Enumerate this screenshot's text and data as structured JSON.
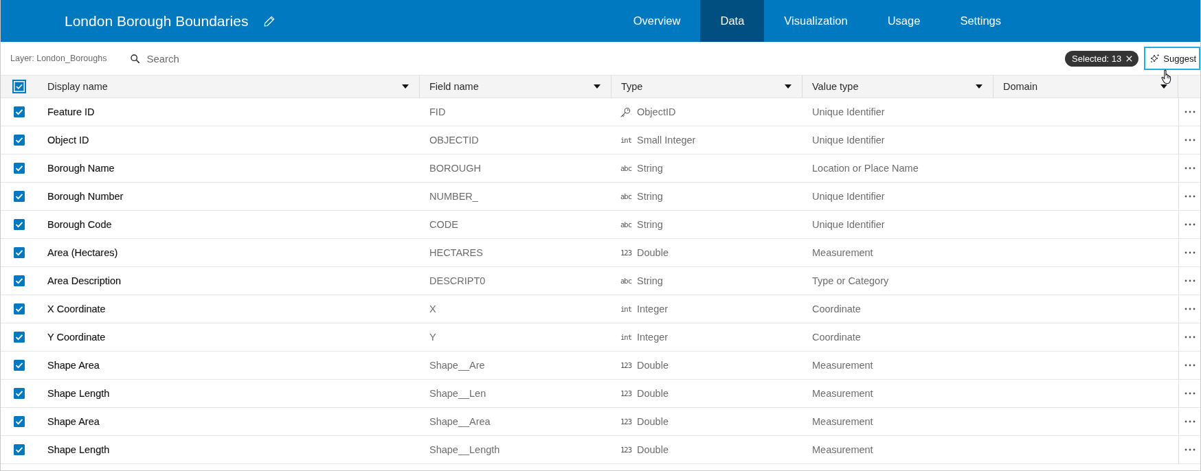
{
  "header": {
    "title": "London Borough Boundaries",
    "tabs": [
      {
        "label": "Overview",
        "selected": false
      },
      {
        "label": "Data",
        "selected": true
      },
      {
        "label": "Visualization",
        "selected": false
      },
      {
        "label": "Usage",
        "selected": false
      },
      {
        "label": "Settings",
        "selected": false
      }
    ]
  },
  "toolbar": {
    "layer": "Layer: London_Boroughs",
    "search": {
      "placeholder": "Search"
    },
    "selection_chip": "Selected: 13",
    "suggest_button": "Suggest"
  },
  "table": {
    "select_all_checked": true,
    "columns": [
      "Display name",
      "Field name",
      "Type",
      "Value type",
      "Domain"
    ],
    "rows": [
      {
        "checked": true,
        "display_name": "Feature ID",
        "field_name": "FID",
        "type": {
          "kind": "key",
          "label": "ObjectID"
        },
        "value_type": "Unique Identifier"
      },
      {
        "checked": true,
        "display_name": "Object ID",
        "field_name": "OBJECTID",
        "type": {
          "kind": "glyph",
          "glyph": "int",
          "label": "Small Integer"
        },
        "value_type": "Unique Identifier"
      },
      {
        "checked": true,
        "display_name": "Borough Name",
        "field_name": "BOROUGH",
        "type": {
          "kind": "glyph",
          "glyph": "abc",
          "label": "String"
        },
        "value_type": "Location or Place Name"
      },
      {
        "checked": true,
        "display_name": "Borough Number",
        "field_name": "NUMBER_",
        "type": {
          "kind": "glyph",
          "glyph": "abc",
          "label": "String"
        },
        "value_type": "Unique Identifier"
      },
      {
        "checked": true,
        "display_name": "Borough Code",
        "field_name": "CODE",
        "type": {
          "kind": "glyph",
          "glyph": "abc",
          "label": "String"
        },
        "value_type": "Unique Identifier"
      },
      {
        "checked": true,
        "display_name": "Area (Hectares)",
        "field_name": "HECTARES",
        "type": {
          "kind": "glyph",
          "glyph": "123",
          "label": "Double"
        },
        "value_type": "Measurement"
      },
      {
        "checked": true,
        "display_name": "Area Description",
        "field_name": "DESCRIPT0",
        "type": {
          "kind": "glyph",
          "glyph": "abc",
          "label": "String"
        },
        "value_type": "Type or Category"
      },
      {
        "checked": true,
        "display_name": "X Coordinate",
        "field_name": "X",
        "type": {
          "kind": "glyph",
          "glyph": "int",
          "label": "Integer"
        },
        "value_type": "Coordinate"
      },
      {
        "checked": true,
        "display_name": "Y Coordinate",
        "field_name": "Y",
        "type": {
          "kind": "glyph",
          "glyph": "int",
          "label": "Integer"
        },
        "value_type": "Coordinate"
      },
      {
        "checked": true,
        "display_name": "Shape Area",
        "field_name": "Shape__Are",
        "type": {
          "kind": "glyph",
          "glyph": "123",
          "label": "Double"
        },
        "value_type": "Measurement"
      },
      {
        "checked": true,
        "display_name": "Shape Length",
        "field_name": "Shape__Len",
        "type": {
          "kind": "glyph",
          "glyph": "123",
          "label": "Double"
        },
        "value_type": "Measurement"
      },
      {
        "checked": true,
        "display_name": "Shape Area",
        "field_name": "Shape__Area",
        "type": {
          "kind": "glyph",
          "glyph": "123",
          "label": "Double"
        },
        "value_type": "Measurement"
      },
      {
        "checked": true,
        "display_name": "Shape Length",
        "field_name": "Shape__Length",
        "type": {
          "kind": "glyph",
          "glyph": "123",
          "label": "Double"
        },
        "value_type": "Measurement"
      }
    ]
  }
}
